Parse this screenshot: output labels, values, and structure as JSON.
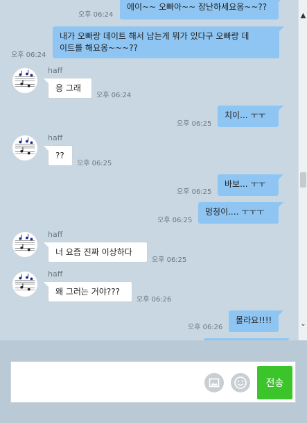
{
  "messages": [
    {
      "side": "me",
      "text": "에이~~ 오빠아~~ 장난하세요옹~~??",
      "time": "오후 06:24"
    },
    {
      "side": "me",
      "text_lines": [
        "내가 오빠랑 데이트 해서 남는게 뭐가 있다구 오빠랑 데",
        "이트를 해요옹~~~??"
      ],
      "time": "오후 06:24"
    },
    {
      "side": "other",
      "sender": "haff",
      "text": "응 그래",
      "time": "오후 06:24"
    },
    {
      "side": "me",
      "text": "치이... ㅜㅜ",
      "time": "오후 06:25"
    },
    {
      "side": "other",
      "sender": "haff",
      "text": "??",
      "time": "오후 06:25"
    },
    {
      "side": "me",
      "text": "바보... ㅜㅜ",
      "time": "오후 06:25"
    },
    {
      "side": "me",
      "text": "멍청이.... ㅜㅜㅜ",
      "time": "오후 06:25"
    },
    {
      "side": "other",
      "sender": "haff",
      "text": "너 요즘 진짜 이상하다",
      "time": "오후 06:25"
    },
    {
      "side": "other",
      "sender": "haff",
      "text": "왜 그러는 거야???",
      "time": "오후 06:26"
    },
    {
      "side": "me",
      "text": "몰라요!!!!",
      "time": "오후 06:26"
    }
  ],
  "composer": {
    "send_label": "전송",
    "image_icon": "image-icon",
    "emoji_icon": "emoji-icon"
  },
  "scrollbar": {
    "up_glyph": "▲",
    "down_glyph": "⌄"
  },
  "colors": {
    "my_bubble": "#8ec5f2",
    "other_bubble": "#ffffff",
    "send_button": "#3cc52a",
    "background": "#c8d7e1"
  }
}
